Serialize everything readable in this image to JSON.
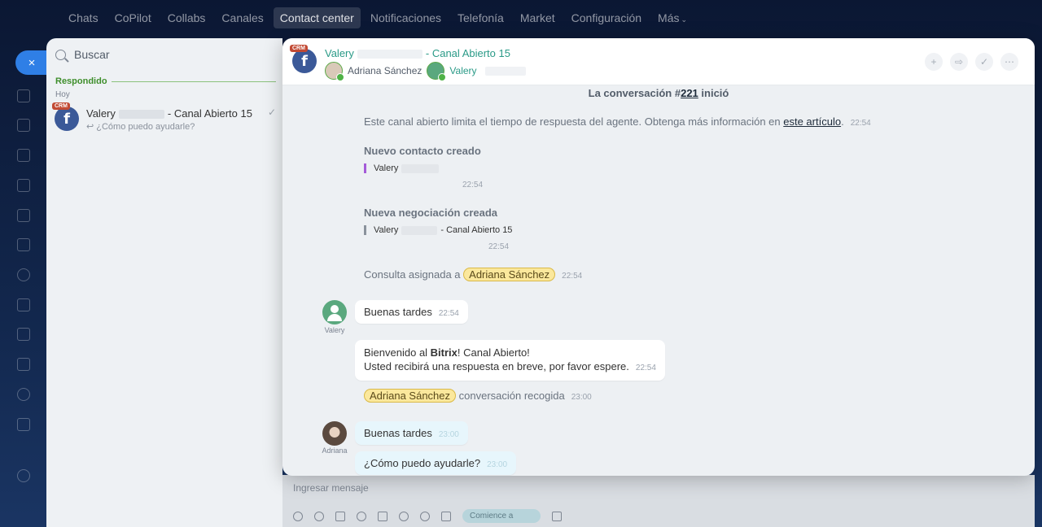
{
  "nav": {
    "items": [
      "Chats",
      "CoPilot",
      "Collabs",
      "Canales",
      "Contact center",
      "Notificaciones",
      "Telefonía",
      "Market",
      "Configuración",
      "Más"
    ],
    "active": "Contact center"
  },
  "rail": {
    "close_icon": "×"
  },
  "chatlist": {
    "search_placeholder": "Buscar",
    "section": "Respondido",
    "date": "Hoy",
    "item": {
      "name_first": "Valery",
      "name_rest": "- Canal Abierto 15",
      "last_message": "↩ ¿Cómo puedo ayudarle?",
      "badge": "CRM"
    }
  },
  "input": {
    "placeholder": "Ingresar mensaje",
    "start_label": "Comience a"
  },
  "header": {
    "badge": "CRM",
    "title_first": "Valery",
    "title_rest": "- Canal Abierto 15",
    "user1": "Adriana Sánchez",
    "user2": "Valery",
    "actions": [
      "+",
      "⇨",
      "✓",
      "⋯"
    ]
  },
  "conversation": {
    "start_prefix": "La conversación #",
    "start_number": "221",
    "start_suffix": " inició",
    "limit_text": "Este canal abierto limita el tiempo de respuesta del agente. Obtenga más información en ",
    "limit_link": "este artículo",
    "limit_after": ".",
    "limit_time": "22:54",
    "new_contact_title": "Nuevo contacto creado",
    "new_contact_name": "Valery",
    "new_contact_time": "22:54",
    "new_deal_title": "Nueva negociación creada",
    "new_deal_name_first": "Valery",
    "new_deal_name_rest": "- Canal Abierto 15",
    "new_deal_time": "22:54",
    "assigned_text": "Consulta asignada a",
    "assigned_name": "Adriana Sánchez",
    "assigned_time": "22:54",
    "msg1_text": "Buenas tardes",
    "msg1_time": "22:54",
    "msg1_author": "Valery",
    "msg2_line1_pre": "Bienvenido al ",
    "msg2_line1_bold": "Bitrix",
    "msg2_line1_post": "! Canal Abierto!",
    "msg2_line2": "Usted recibirá una respuesta en breve, por favor espere.",
    "msg2_time": "22:54",
    "picked_name": "Adriana Sánchez",
    "picked_text": "conversación recogida",
    "picked_time": "23:00",
    "msg3_text": "Buenas tardes",
    "msg3_time": "23:00",
    "msg3_author": "Adriana",
    "msg4_text": "¿Cómo puedo ayudarle?",
    "msg4_time": "23:00"
  }
}
